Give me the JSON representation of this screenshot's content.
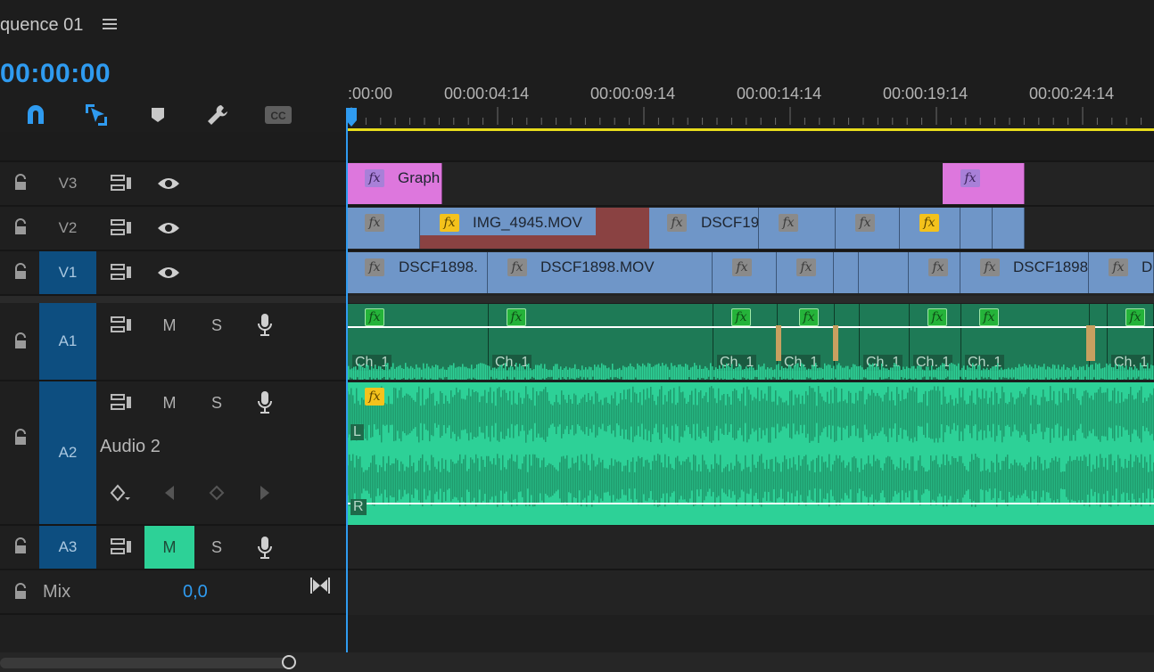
{
  "header": {
    "title": "quence 01",
    "timecode": "00:00:00"
  },
  "ruler": {
    "labels": [
      ":00:00",
      "00:00:04:14",
      "00:00:09:14",
      "00:00:14:14",
      "00:00:19:14",
      "00:00:24:14"
    ]
  },
  "tracks": {
    "v3": {
      "name": "V3"
    },
    "v2": {
      "name": "V2"
    },
    "v1": {
      "name": "V1"
    },
    "a1": {
      "name": "A1",
      "mute": "M",
      "solo": "S"
    },
    "a2": {
      "name": "A2",
      "mute": "M",
      "solo": "S",
      "label": "Audio 2"
    },
    "a3": {
      "name": "A3",
      "mute": "M",
      "solo": "S"
    },
    "mix": {
      "label": "Mix",
      "value": "0,0"
    }
  },
  "clips": {
    "v3": [
      "Graph"
    ],
    "v2": [
      "IMG_4945.MOV",
      "DSCF19"
    ],
    "v1": [
      "DSCF1898.",
      "DSCF1898.MOV",
      "DSCF1898",
      "D"
    ],
    "channel_label": "Ch. 1",
    "a2_left": "L",
    "a2_right": "R"
  },
  "fx_label": "fx",
  "colors": {
    "accent": "#2f9bf0",
    "video_clip": "#6f96c8",
    "graphic_clip": "#dd77dd",
    "audio_clip": "#2dd197",
    "playhead": "#2f9bf0",
    "work_area": "#f0e020"
  }
}
